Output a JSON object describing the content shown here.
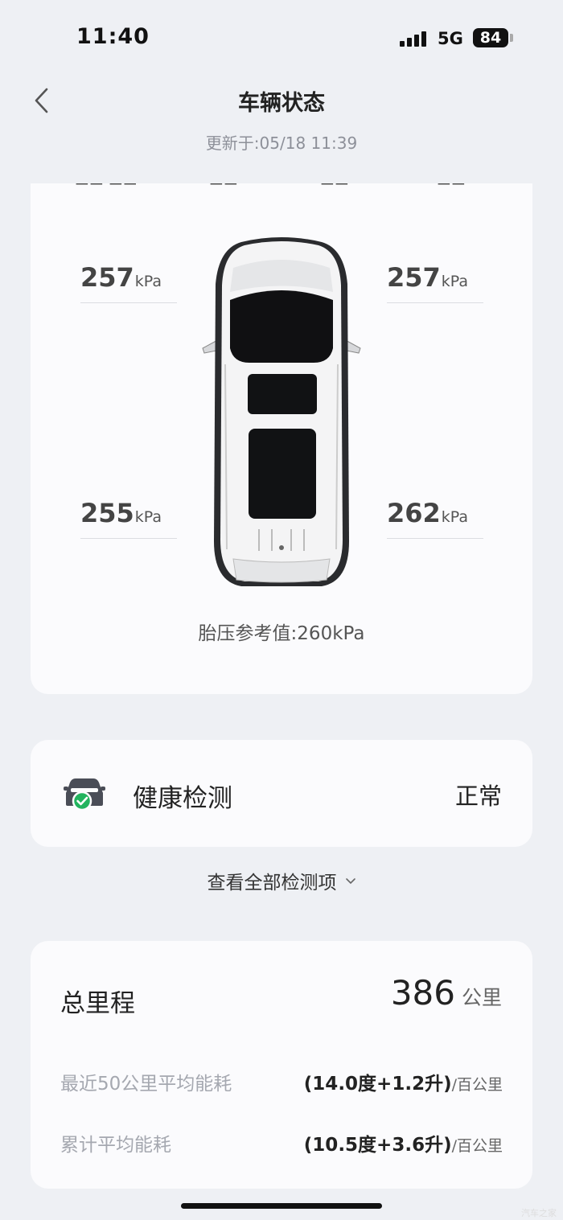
{
  "status_bar": {
    "time": "11:40",
    "network": "5G",
    "battery": "84"
  },
  "header": {
    "back_icon": "chevron-left-icon",
    "title": "车辆状态",
    "updated": "更新于:05/18 11:39"
  },
  "tires": {
    "front_left": {
      "value": "257",
      "unit": "kPa"
    },
    "front_right": {
      "value": "257",
      "unit": "kPa"
    },
    "rear_left": {
      "value": "255",
      "unit": "kPa"
    },
    "rear_right": {
      "value": "262",
      "unit": "kPa"
    },
    "reference_label": "胎压参考值:",
    "reference_value": "260kPa"
  },
  "health": {
    "icon": "car-check-icon",
    "label": "健康检测",
    "status": "正常",
    "view_all": "查看全部检测项",
    "accent_color": "#22b35e"
  },
  "mileage": {
    "label": "总里程",
    "value": "386",
    "unit": "公里",
    "rows": [
      {
        "label": "最近50公里平均能耗",
        "value": "(14.0度+1.2升)",
        "unit": "/百公里"
      },
      {
        "label": "累计平均能耗",
        "value": "(10.5度+3.6升)",
        "unit": "/百公里"
      }
    ]
  },
  "watermark": "汽车之家"
}
